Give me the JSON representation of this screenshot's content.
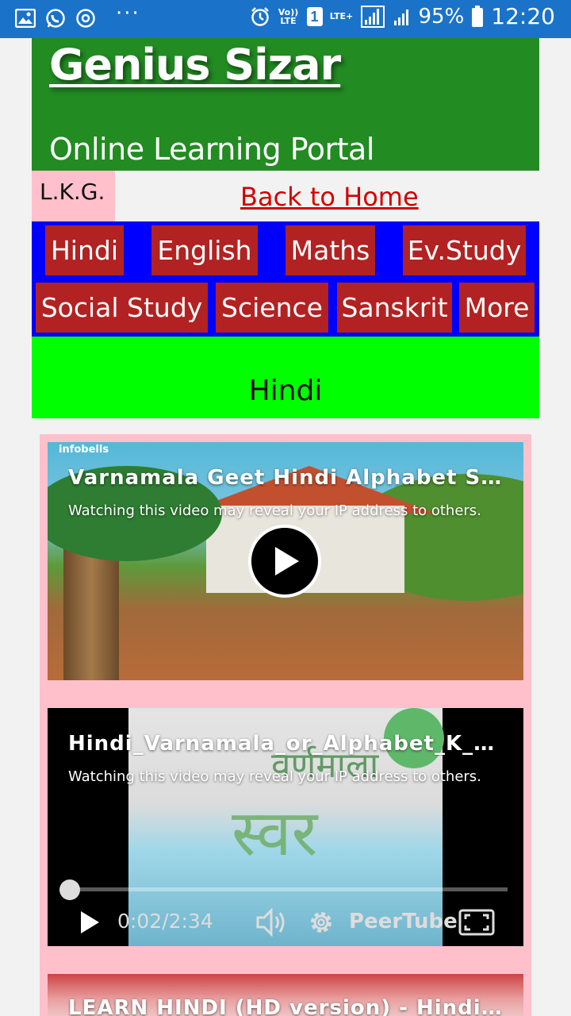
{
  "status_bar": {
    "signal_label": "Vo)) LTE",
    "sim_slot": "1",
    "network": "LTE+",
    "battery": "95%",
    "time": "12:20"
  },
  "header": {
    "title": "Genius Sizar",
    "subtitle": "Online Learning Portal"
  },
  "grade": "L.K.G.",
  "home_link": "Back to Home",
  "subjects": [
    "Hindi",
    "English",
    "Maths",
    "Ev.Study",
    "Social Study",
    "Science",
    "Sanskrit",
    "More"
  ],
  "section_title": "Hindi",
  "videos": [
    {
      "title": "Varnamala Geet Hindi Alphabet Song",
      "warning": "Watching this video may reveal your IP address to others.",
      "watermark": "infobells"
    },
    {
      "title": "Hindi_Varnamala_or_Alphabet_K_Kh…",
      "warning": "Watching this video may reveal your IP address to others.",
      "thumbnail_text_top": "वर्णमाला",
      "thumbnail_text": "स्वर",
      "current_time": "0:02",
      "duration": "2:34",
      "progress": 0.013,
      "player_brand": "PeerTube"
    },
    {
      "title": "LEARN HINDI (HD version) - Hindi…"
    }
  ],
  "colors": {
    "status_bar": "#1a73c9",
    "header": "#228b22",
    "grade_bg": "#ffc0cb",
    "nav_bg": "#0000ff",
    "subject_button": "#b22222",
    "section_bg": "#00ff00",
    "link": "#d40000"
  }
}
